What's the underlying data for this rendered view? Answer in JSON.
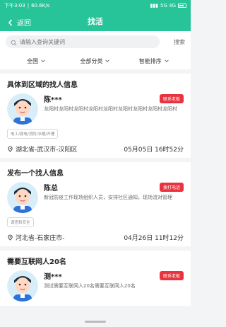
{
  "status": {
    "time": "下午3:03",
    "speed": "60.6K/s",
    "signals": "5G 4G",
    "battery_percent": 60
  },
  "nav": {
    "back_label": "返回",
    "title": "找活"
  },
  "search": {
    "placeholder": "请输入查询关键词",
    "button_label": "搜索"
  },
  "filters": [
    {
      "label": "全国"
    },
    {
      "label": "全部分类"
    },
    {
      "label": "智能排序"
    }
  ],
  "cards": [
    {
      "header": "具体到区域的找人信息",
      "name": "陈***",
      "badge": "联系老板",
      "desc": "龙阳村龙阳村龙阳村龙阳村龙阳村龙阳村龙阳村龙阳村龙阳村",
      "tags": [
        "电工/弱电/消防/水暖/开槽"
      ],
      "location": "湖北省-武汉市-汉阳区",
      "datetime": "05月05日 16时52分"
    },
    {
      "header": "发布一个找人信息",
      "name": "陈总",
      "badge": "拨打电话",
      "desc": "新冠防疫工作现场组织人员，安排社区通知，现场流对管理",
      "tags": [
        "调查和安全"
      ],
      "location": "河北省-石家庄市-",
      "datetime": "04月26日 11时12分"
    },
    {
      "header": "需要互联网人20名",
      "name": "测***",
      "badge": "联系老板",
      "desc": "测试需要互联网人20名需要互联网人20名",
      "tags": [],
      "location": "",
      "datetime": ""
    }
  ],
  "colors": {
    "accent": "#27c49a",
    "danger": "#e9343f"
  },
  "icons": {
    "back": "chevron-left-icon",
    "search": "search-icon",
    "dropdown": "chevron-down-icon",
    "location": "location-pin-icon"
  }
}
